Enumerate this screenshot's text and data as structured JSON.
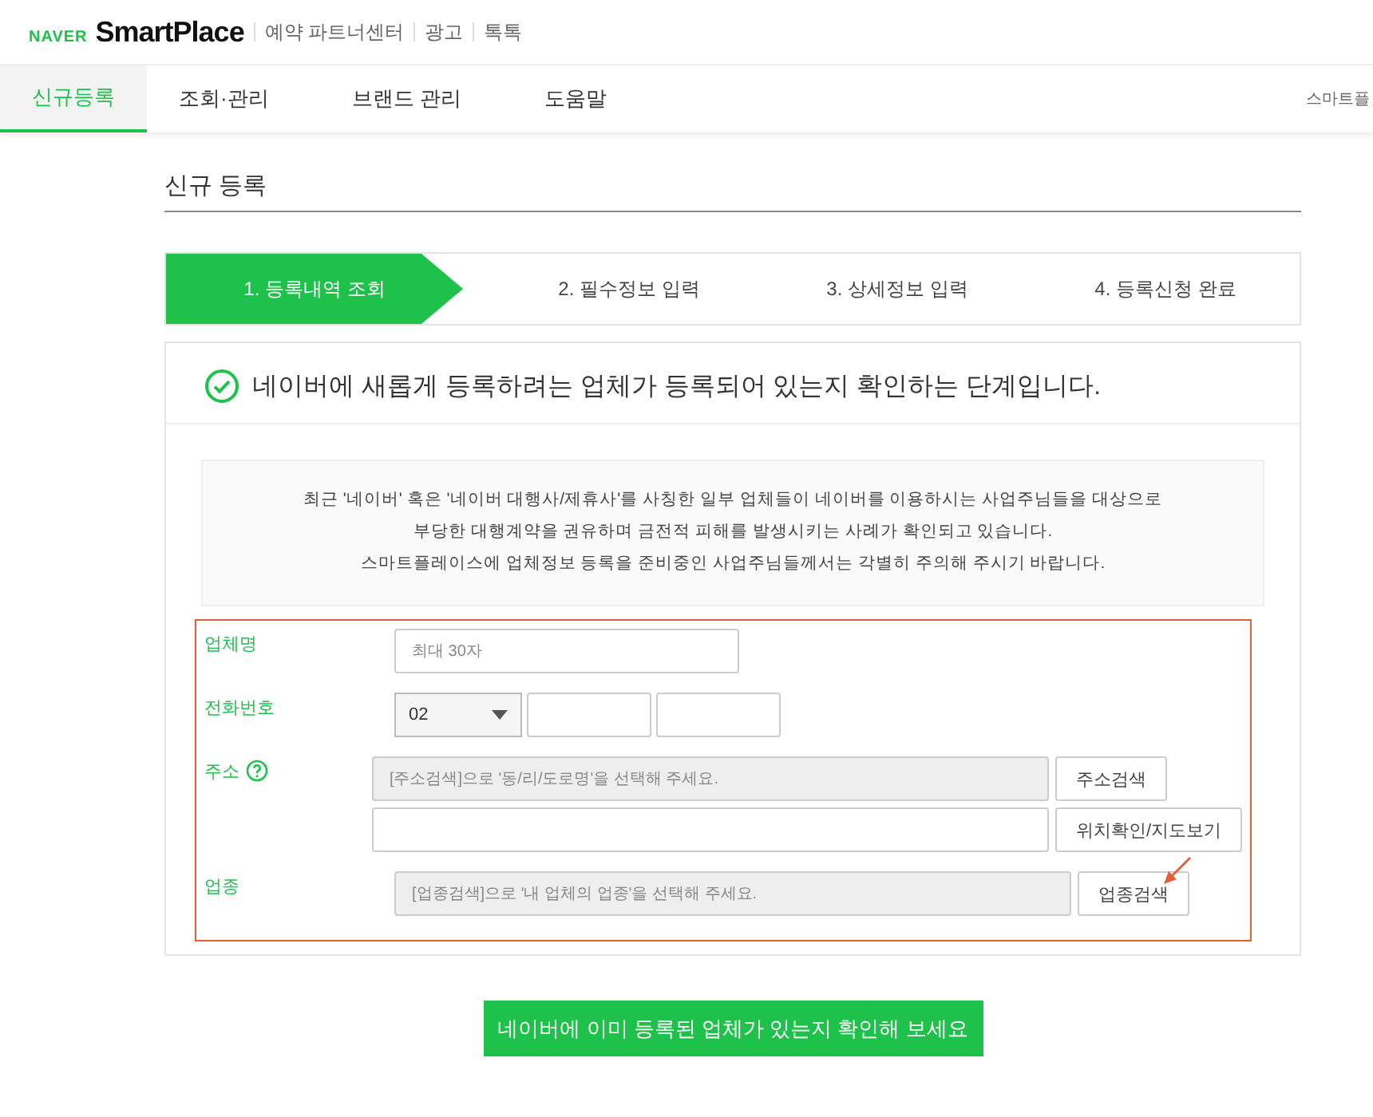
{
  "header": {
    "logo_brand": "NAVER",
    "logo_product": "SmartPlace",
    "links": [
      "예약 파트너센터",
      "광고",
      "톡톡"
    ]
  },
  "nav": {
    "tabs": [
      {
        "label": "신규등록",
        "selected": true
      },
      {
        "label": "조회·관리",
        "selected": false
      },
      {
        "label": "브랜드 관리",
        "selected": false
      },
      {
        "label": "도움말",
        "selected": false
      }
    ],
    "right_link": "스마트플"
  },
  "page_title": "신규 등록",
  "steps": [
    {
      "label": "1. 등록내역 조회",
      "selected": true
    },
    {
      "label": "2. 필수정보 입력",
      "selected": false
    },
    {
      "label": "3. 상세정보 입력",
      "selected": false
    },
    {
      "label": "4. 등록신청 완료",
      "selected": false
    }
  ],
  "intro": "네이버에 새롭게 등록하려는 업체가 등록되어 있는지 확인하는 단계입니다.",
  "notice": [
    "최근 '네이버' 혹은 '네이버 대행사/제휴사'를 사칭한 일부 업체들이 네이버를 이용하시는 사업주님들을 대상으로",
    "부당한 대행계약을 권유하며 금전적 피해를 발생시키는 사례가 확인되고 있습니다.",
    "스마트플레이스에 업체정보 등록을 준비중인 사업주님들께서는 각별히 주의해 주시기 바랍니다."
  ],
  "form": [
    {
      "kind": "name",
      "label": "업체명",
      "help": false,
      "lines": [
        {
          "inputs": [
            {
              "placeholder": "최대 30자",
              "disabled": false
            }
          ]
        }
      ]
    },
    {
      "kind": "phone",
      "label": "전화번호",
      "help": false,
      "select": "02",
      "lines": [
        {
          "inputs": [
            {
              "disabled": false
            },
            {
              "disabled": false
            }
          ]
        }
      ]
    },
    {
      "kind": "address",
      "label": "주소",
      "help": true,
      "lines": [
        {
          "inputs": [
            {
              "placeholder": "[주소검색]으로 '동/리/도로명'을 선택해 주세요.",
              "disabled": true
            }
          ],
          "button": "주소검색"
        },
        {
          "inputs": [
            {
              "disabled": false
            }
          ],
          "button": "위치확인/지도보기"
        }
      ]
    },
    {
      "kind": "category",
      "label": "업종",
      "help": false,
      "lines": [
        {
          "inputs": [
            {
              "placeholder": "[업종검색]으로 '내 업체의 업종'을 선택해 주세요.",
              "disabled": true
            }
          ],
          "button": "업종검색"
        }
      ]
    }
  ],
  "submit": "네이버에 이미 등록된 업체가 있는지 확인해 보세요"
}
